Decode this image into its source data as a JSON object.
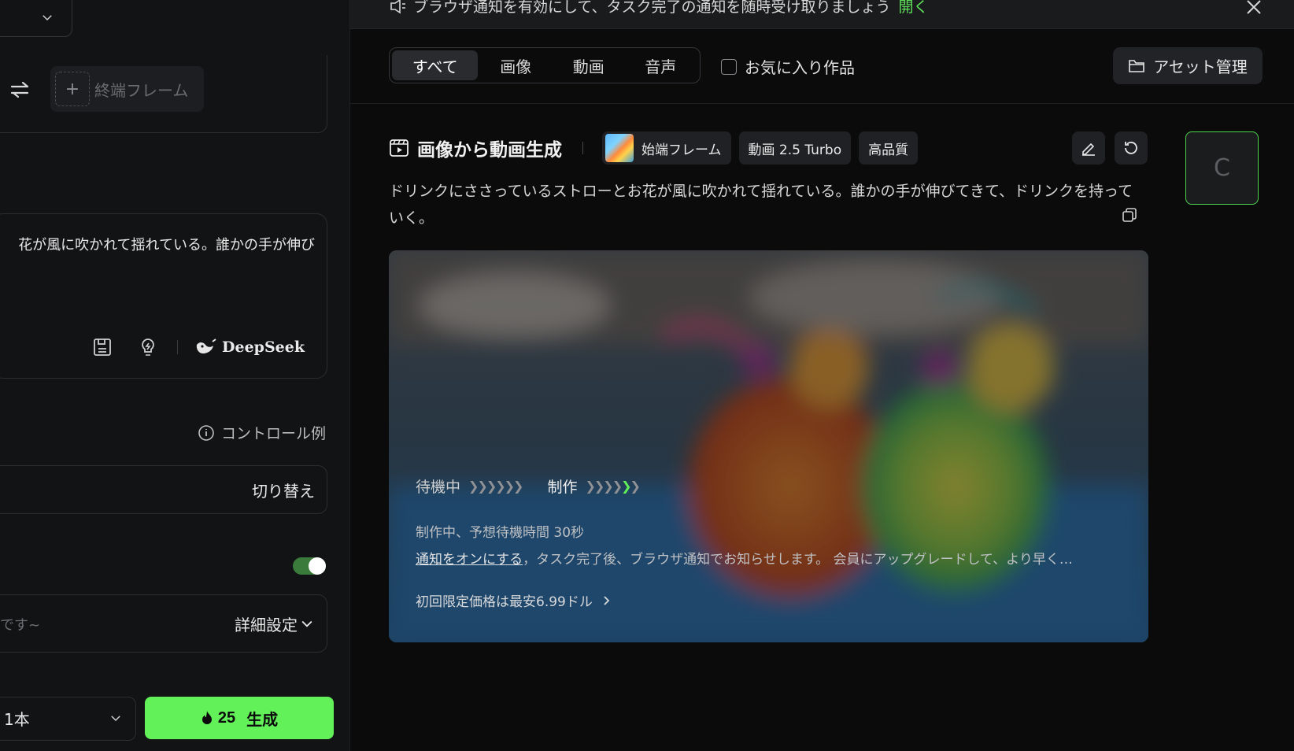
{
  "left_panel": {
    "end_frame_label": "終端フレーム",
    "prompt_text": "花が風に吹かれて揺れている。誰かの手が伸び",
    "ai_brand": "DeepSeek",
    "control_example": "コントロール例",
    "switch_label": "切り替え",
    "detail_placeholder": "です~",
    "detail_label": "詳細設定",
    "count_value": "1本",
    "generate_cost": "25",
    "generate_label": "生成",
    "toggle_on": true
  },
  "banner": {
    "message": "ブラウザ通知を有効にして、タスク完了の通知を随時受け取りましょう",
    "open_link": "開く"
  },
  "filter": {
    "tabs": [
      "すべて",
      "画像",
      "動画",
      "音声"
    ],
    "active_tab": "すべて",
    "favorites_label": "お気に入り作品",
    "asset_button": "アセット管理"
  },
  "task": {
    "title": "画像から動画生成",
    "chips": [
      "始端フレーム",
      "動画 2.5 Turbo",
      "高品質"
    ],
    "description": "ドリンクにささっているストローとお花が風に吹かれて揺れている。誰かの手が伸びてきて、ドリンクを持っていく。",
    "side_card_glyph": "C",
    "status_waiting": "待機中",
    "status_making": "制作",
    "progress_info": "制作中、予想待機時間 30秒",
    "notify_link": "通知をオンにする",
    "notify_text": "，タスク完了後、ブラウザ通知でお知らせします。 会員にアップグレードして、より早く…",
    "promo_text": "初回限定価格は最安6.99ドル"
  },
  "colors": {
    "accent": "#63f15a",
    "background": "#0b0b0c",
    "panel": "#121315"
  }
}
